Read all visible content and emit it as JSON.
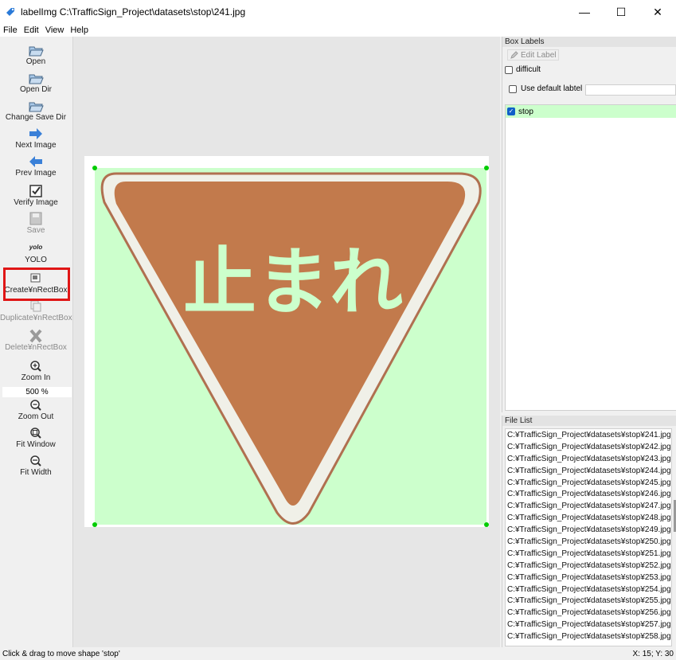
{
  "window": {
    "title": "labelImg C:\\TrafficSign_Project\\datasets\\stop\\241.jpg",
    "controls": [
      "—",
      "☐",
      "✕"
    ]
  },
  "menu": [
    "File",
    "Edit",
    "View",
    "Help"
  ],
  "toolbar": {
    "open": "Open",
    "open_dir": "Open Dir",
    "change_save_dir": "Change Save Dir",
    "next_image": "Next Image",
    "prev_image": "Prev Image",
    "verify_image": "Verify Image",
    "save": "Save",
    "format_badge": "yolo",
    "format": "YOLO",
    "create_rectbox": "Create¥nRectBox",
    "duplicate_rectbox": "Duplicate¥nRectBox",
    "delete_rectbox": "Delete¥nRectBox",
    "zoom_in": "Zoom In",
    "zoom_level": "500 %",
    "zoom_out": "Zoom Out",
    "fit_window": "Fit Window",
    "fit_width": "Fit Width"
  },
  "canvas": {
    "sign_text": "止まれ",
    "box_label": "stop",
    "colors": {
      "sign_fill": "#c27a4c",
      "sign_border": "#b07050",
      "box_fill": "#ccffcc",
      "handle": "#00cc00"
    }
  },
  "box_labels": {
    "header": "Box Labels",
    "edit_label": "Edit Label",
    "difficult": "difficult",
    "use_default_label": "Use default labtel",
    "items": [
      {
        "label": "stop",
        "checked": true
      }
    ]
  },
  "file_list": {
    "header": "File List",
    "files": [
      "C:¥TrafficSign_Project¥datasets¥stop¥241.jpg",
      "C:¥TrafficSign_Project¥datasets¥stop¥242.jpg",
      "C:¥TrafficSign_Project¥datasets¥stop¥243.jpg",
      "C:¥TrafficSign_Project¥datasets¥stop¥244.jpg",
      "C:¥TrafficSign_Project¥datasets¥stop¥245.jpg",
      "C:¥TrafficSign_Project¥datasets¥stop¥246.jpg",
      "C:¥TrafficSign_Project¥datasets¥stop¥247.jpg",
      "C:¥TrafficSign_Project¥datasets¥stop¥248.jpg",
      "C:¥TrafficSign_Project¥datasets¥stop¥249.jpg",
      "C:¥TrafficSign_Project¥datasets¥stop¥250.jpg",
      "C:¥TrafficSign_Project¥datasets¥stop¥251.jpg",
      "C:¥TrafficSign_Project¥datasets¥stop¥252.jpg",
      "C:¥TrafficSign_Project¥datasets¥stop¥253.jpg",
      "C:¥TrafficSign_Project¥datasets¥stop¥254.jpg",
      "C:¥TrafficSign_Project¥datasets¥stop¥255.jpg",
      "C:¥TrafficSign_Project¥datasets¥stop¥256.jpg",
      "C:¥TrafficSign_Project¥datasets¥stop¥257.jpg",
      "C:¥TrafficSign_Project¥datasets¥stop¥258.jpg"
    ]
  },
  "status": {
    "message": "Click & drag to move shape 'stop'",
    "coords": "X: 15; Y: 30"
  }
}
